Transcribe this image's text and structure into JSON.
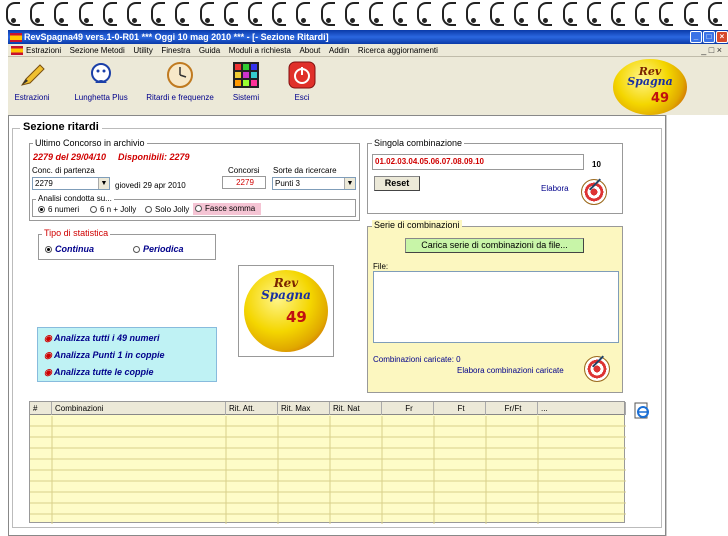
{
  "window": {
    "title": "RevSpagna49 vers.1-0-R01  ***  Oggi 10 mag 2010  ***  - [- Sezione Ritardi]"
  },
  "menu": [
    "Estrazioni",
    "Sezione Metodi",
    "Utility",
    "Finestra",
    "Guida",
    "Moduli a richiesta",
    "About",
    "Addin",
    "Ricerca aggiornamenti"
  ],
  "toolbar": {
    "items": [
      "Estrazioni",
      "Lunghetta Plus",
      "Ritardi e frequenze",
      "Sistemi",
      "Esci"
    ]
  },
  "logo": {
    "rev": "Rev",
    "spagna": "Spagna",
    "num": "49"
  },
  "section": {
    "title": "Sezione ritardi",
    "archive": {
      "label": "Ultimo Concorso in archivio",
      "last": "2279 del 29/04/10",
      "available": "Disponibili: 2279",
      "conc_label": "Conc. di partenza",
      "conc_value": "2279",
      "date_text": "giovedì 29 apr 2010",
      "concorsi_label": "Concorsi",
      "concorsi_value": "2279",
      "sorte_label": "Sorte da ricercare",
      "sorte_value": "Punti 3",
      "analysis_label": "Analisi condotta su...",
      "analysis_options": [
        "6 numeri",
        "6 n + Jolly",
        "Solo Jolly",
        "Fasce somma"
      ]
    },
    "stat": {
      "label": "Tipo di statistica",
      "options": [
        "Continua",
        "Periodica"
      ]
    },
    "analyze_links": [
      "Analizza tutti i 49 numeri",
      "Analizza Punti 1 in coppie",
      "Analizza tutte le coppie"
    ],
    "single": {
      "label": "Singola combinazione",
      "value": "01.02.03.04.05.06.07.08.09.10",
      "count": "10",
      "reset_label": "Reset",
      "elabora_label": "Elabora"
    },
    "series": {
      "label": "Serie di combinazioni",
      "load_button": "Carica serie di combinazioni da file...",
      "file_label": "File:",
      "loaded_label": "Combinazioni caricate: 0",
      "elabora_loaded": "Elabora combinazioni caricate"
    },
    "table": {
      "columns": [
        "#",
        "Combinazioni",
        "Rit. Att.",
        "Rit. Max",
        "Rit. Nat",
        "Fr",
        "Ft",
        "Fr/Ft",
        "..."
      ]
    }
  }
}
